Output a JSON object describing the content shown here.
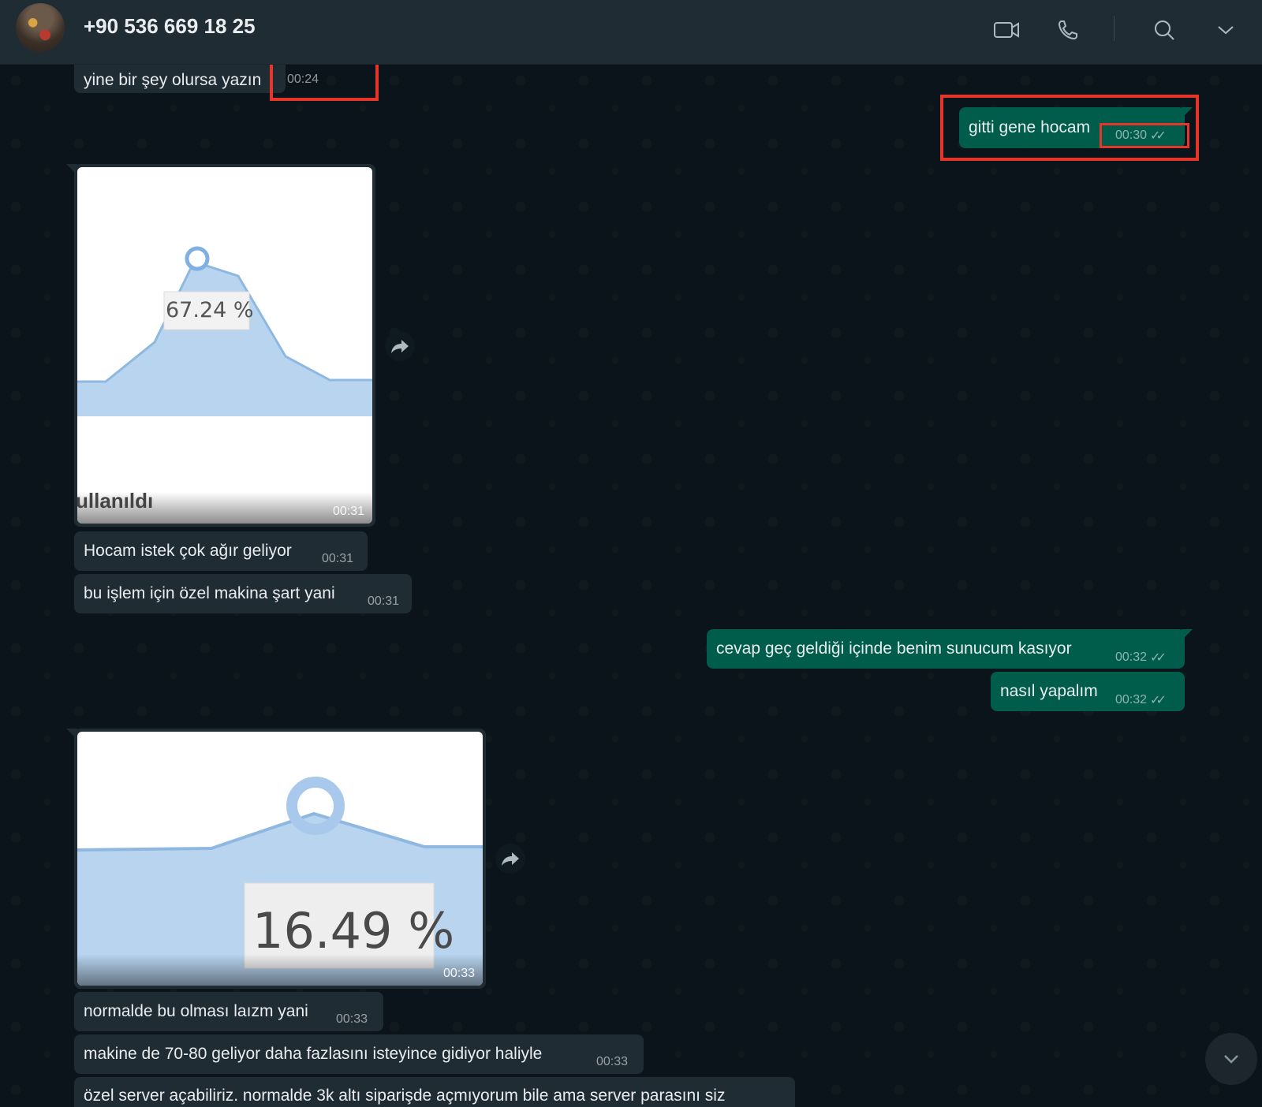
{
  "header": {
    "contact_name": "+90 536 669 18 25"
  },
  "messages": [
    {
      "text": "yine bir şey olursa yazın",
      "time": "00:24"
    },
    {
      "text": "gitti gene hocam",
      "time": "00:30"
    },
    {
      "image_label": "67.24 %",
      "image_footer_text": "ullanıldı",
      "time": "00:31"
    },
    {
      "text": "Hocam istek çok ağır geliyor",
      "time": "00:31"
    },
    {
      "text": "bu işlem için özel makina şart yani",
      "time": "00:31"
    },
    {
      "text": "cevap geç geldiği içinde benim sunucum kasıyor",
      "time": "00:32"
    },
    {
      "text": "nasıl yapalım",
      "time": "00:32"
    },
    {
      "image_label": "16.49 %",
      "time": "00:33"
    },
    {
      "text": "normalde bu olması laızm yani",
      "time": "00:33"
    },
    {
      "text": "makine de 70-80 geliyor daha fazlasını isteyince gidiyor haliyle",
      "time": "00:33"
    },
    {
      "text": "özel server açabiliriz. normalde 3k altı siparişde açmıyorum bile ama server parasını siz"
    }
  ],
  "colors": {
    "outgoing_bubble": "#005c4b",
    "incoming_bubble": "#202c33",
    "highlight": "#e8352a",
    "chart_fill": "#b8d4ef"
  }
}
